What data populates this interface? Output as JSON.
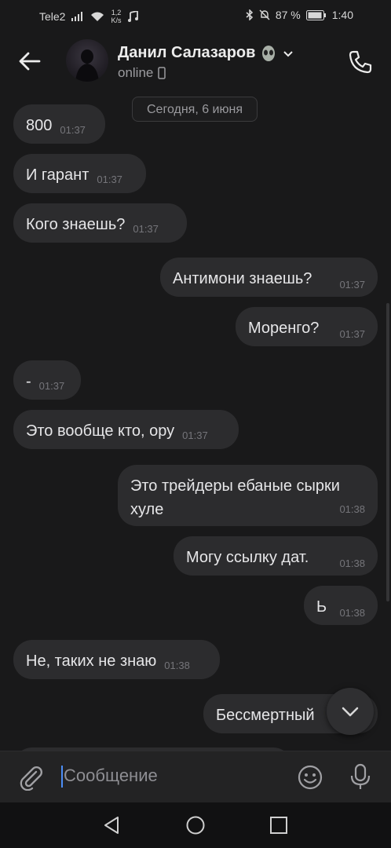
{
  "status_bar": {
    "carrier": "Tele2",
    "speed_value": "1,2",
    "speed_unit": "K/s",
    "battery": "87 %",
    "time": "1:40"
  },
  "header": {
    "contact_name": "Данил Салазаров",
    "status": "online"
  },
  "chat": {
    "date_label": "Сегодня, 6 июня",
    "messages": [
      {
        "text": "800",
        "time": "01:37"
      },
      {
        "text": "И гарант",
        "time": "01:37"
      },
      {
        "text": "Кого знаешь?",
        "time": "01:37"
      },
      {
        "text": "Антимони знаешь?",
        "time": "01:37"
      },
      {
        "text": "Моренго?",
        "time": "01:37"
      },
      {
        "text": "-",
        "time": "01:37"
      },
      {
        "text": "Это вообще кто, ору",
        "time": "01:37"
      },
      {
        "text": "Это трейдеры ебаные сырки хуле",
        "time": "01:38"
      },
      {
        "text": "Могу ссылку дат.",
        "time": "01:38"
      },
      {
        "text": "Ь",
        "time": "01:38"
      },
      {
        "text": "Не, таких не знаю",
        "time": "01:38"
      },
      {
        "text": "Бессмертный",
        "time": ""
      }
    ]
  },
  "input": {
    "placeholder": "Сообщение"
  },
  "colors": {
    "background": "#19191a",
    "bubble": "#2c2c2e",
    "accent_cursor": "#4c8df6"
  }
}
